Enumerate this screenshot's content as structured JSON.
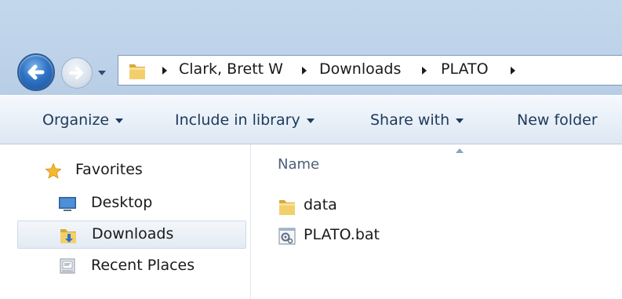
{
  "address": {
    "crumbs": [
      "Clark, Brett W",
      "Downloads",
      "PLATO"
    ]
  },
  "toolbar": {
    "organize": "Organize",
    "include": "Include in library",
    "share": "Share with",
    "new_folder": "New folder"
  },
  "nav": {
    "favorites": "Favorites",
    "items": [
      {
        "label": "Desktop",
        "icon": "desktop-icon"
      },
      {
        "label": "Downloads",
        "icon": "downloads-folder-icon",
        "selected": true
      },
      {
        "label": "Recent Places",
        "icon": "recent-places-icon"
      }
    ]
  },
  "content": {
    "column_name": "Name",
    "files": [
      {
        "name": "data",
        "icon": "folder-icon"
      },
      {
        "name": "PLATO.bat",
        "icon": "batch-file-icon"
      }
    ]
  },
  "colors": {
    "titlebar": "#bed3e9",
    "accent": "#2e72c4",
    "toolbar_text": "#1e395b",
    "folder": "#e8c15a"
  }
}
